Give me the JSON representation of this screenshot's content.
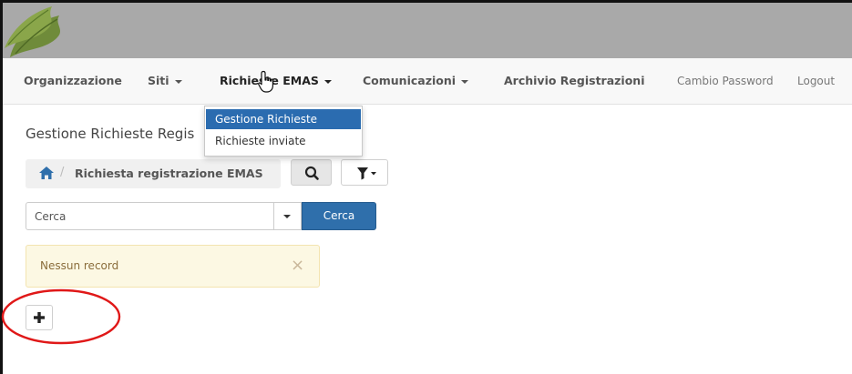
{
  "nav": {
    "items": [
      {
        "label": "Organizzazione"
      },
      {
        "label": "Siti"
      },
      {
        "label": "Richieste EMAS"
      },
      {
        "label": "Comunicazioni"
      },
      {
        "label": "Archivio Registrazioni"
      },
      {
        "label": "Cambio Password"
      },
      {
        "label": "Logout"
      }
    ]
  },
  "dropdown": {
    "items": [
      {
        "label": "Gestione Richieste",
        "selected": true
      },
      {
        "label": "Richieste inviate",
        "selected": false
      }
    ]
  },
  "page": {
    "title": "Gestione Richieste Regis"
  },
  "breadcrumb": {
    "label": "Richiesta registrazione EMAS"
  },
  "search": {
    "placeholder": "Cerca",
    "button_label": "Cerca"
  },
  "alert": {
    "message": "Nessun record",
    "close_symbol": "×"
  },
  "colors": {
    "accent": "#2f6fab",
    "dropdown_selected": "#2b6cb0",
    "alert_bg": "#fcf8e3",
    "alert_text": "#8a6d3b",
    "annotation": "#e01818"
  },
  "icons": {
    "home": "home-icon",
    "search": "search-icon",
    "filter": "filter-icon",
    "add": "plus-icon",
    "cursor": "hand-pointer-icon"
  }
}
